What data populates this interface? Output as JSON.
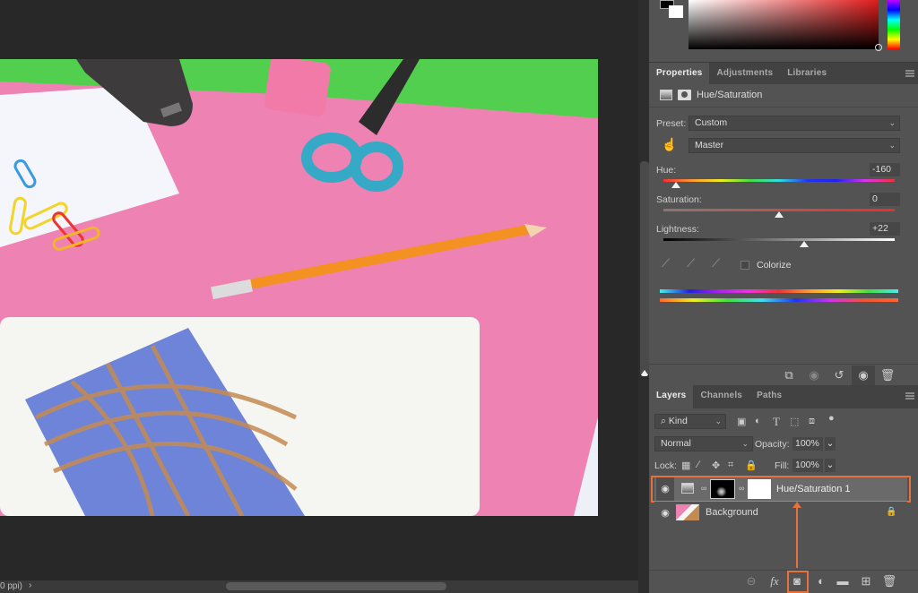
{
  "status_bar": {
    "zoom_text": "0 ppi)",
    "arrow": "›"
  },
  "color_panel": {
    "foreground": "#000000",
    "background": "#ffffff",
    "field_hue": "#e11b1b"
  },
  "properties": {
    "tabs": [
      {
        "label": "Properties",
        "active": true
      },
      {
        "label": "Adjustments",
        "active": false
      },
      {
        "label": "Libraries",
        "active": false
      }
    ],
    "adjustment_title": "Hue/Saturation",
    "preset_label": "Preset:",
    "preset_value": "Custom",
    "channel_value": "Master",
    "hue": {
      "label": "Hue:",
      "value": "-160",
      "min": -180,
      "max": 180,
      "position": -160
    },
    "saturation": {
      "label": "Saturation:",
      "value": "0",
      "min": -100,
      "max": 100,
      "position": 0
    },
    "lightness": {
      "label": "Lightness:",
      "value": "+22",
      "min": -100,
      "max": 100,
      "position": 22
    },
    "colorize_label": "Colorize",
    "colorize_checked": false,
    "footer_icons": [
      "clip-to-layer-icon",
      "view-previous-icon",
      "reset-icon",
      "visibility-icon",
      "delete-icon"
    ]
  },
  "layers": {
    "tabs": [
      {
        "label": "Layers",
        "active": true
      },
      {
        "label": "Channels",
        "active": false
      },
      {
        "label": "Paths",
        "active": false
      }
    ],
    "filter_kind": "Kind",
    "blend_mode": "Normal",
    "opacity_label": "Opacity:",
    "opacity_value": "100%",
    "lock_label": "Lock:",
    "fill_label": "Fill:",
    "fill_value": "100%",
    "items": [
      {
        "name": "Hue/Saturation 1",
        "visible": true,
        "selected": true,
        "type": "adjustment"
      },
      {
        "name": "Background",
        "visible": true,
        "selected": false,
        "type": "pixel",
        "locked": true
      }
    ],
    "footer_icons": [
      "link-layers-icon",
      "fx-icon",
      "add-mask-icon",
      "adjustment-layer-icon",
      "group-icon",
      "new-layer-icon",
      "delete-layer-icon"
    ]
  },
  "annotation": {
    "color": "#e8703a",
    "note": "Add layer mask button highlighted with arrow to selected layer"
  }
}
